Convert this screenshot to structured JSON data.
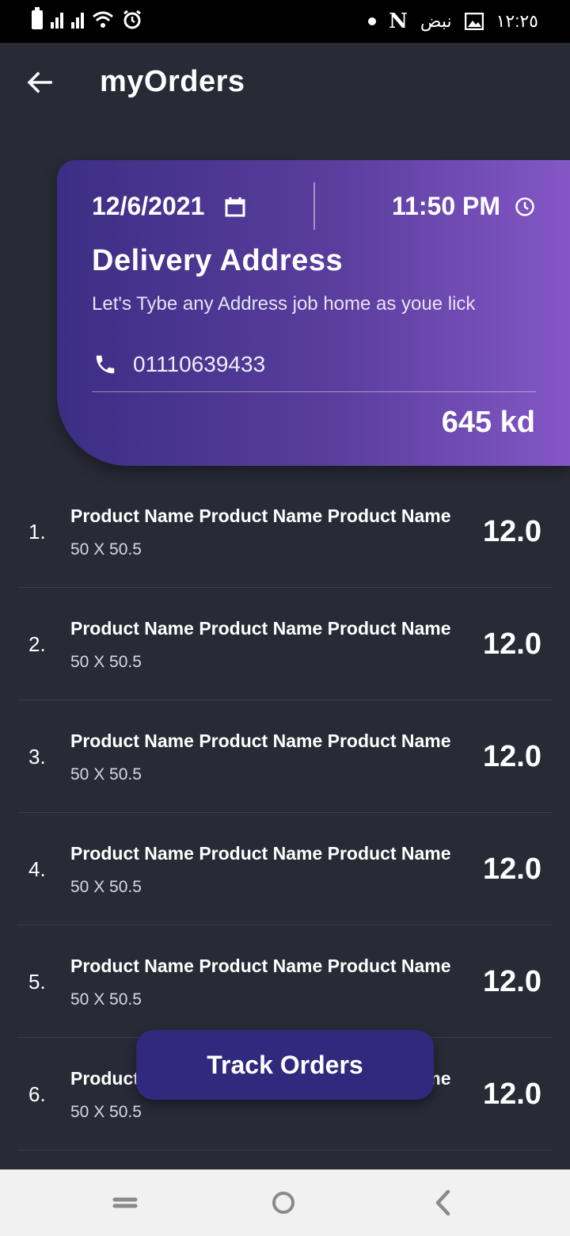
{
  "status_bar": {
    "time": "١٢:٢٥",
    "carrier_text": "نبض",
    "netflix_glyph": "N"
  },
  "app_bar": {
    "title": "myOrders",
    "back_icon": "arrow-left-icon"
  },
  "order_card": {
    "date": "12/6/2021",
    "time": "11:50 PM",
    "heading": "Delivery Address",
    "address": "Let's Tybe any Address job home as youe lick",
    "phone": "01110639433",
    "total": "645 kd",
    "gradient_start": "#3c2e84",
    "gradient_end": "#8457c6"
  },
  "orders": [
    {
      "index": "1.",
      "name": "Product Name Product Name Product Name",
      "size": "50 X 50.5",
      "price": "12.0"
    },
    {
      "index": "2.",
      "name": "Product Name Product Name Product Name",
      "size": "50 X 50.5",
      "price": "12.0"
    },
    {
      "index": "3.",
      "name": "Product Name Product Name Product Name",
      "size": "50 X 50.5",
      "price": "12.0"
    },
    {
      "index": "4.",
      "name": "Product Name Product Name Product Name",
      "size": "50 X 50.5",
      "price": "12.0"
    },
    {
      "index": "5.",
      "name": "Product Name Product Name Product Name",
      "size": "50 X 50.5",
      "price": "12.0"
    },
    {
      "index": "6.",
      "name": "Product Name Product Name Product Name",
      "size": "50 X 50.5",
      "price": "12.0"
    }
  ],
  "track_button": {
    "label": "Track Orders",
    "color": "#30297e"
  },
  "nav_bar": {
    "icons": [
      "recent-apps-icon",
      "home-icon",
      "back-icon"
    ]
  },
  "colors": {
    "background": "#282a36",
    "divider": "#3b3d4a"
  }
}
